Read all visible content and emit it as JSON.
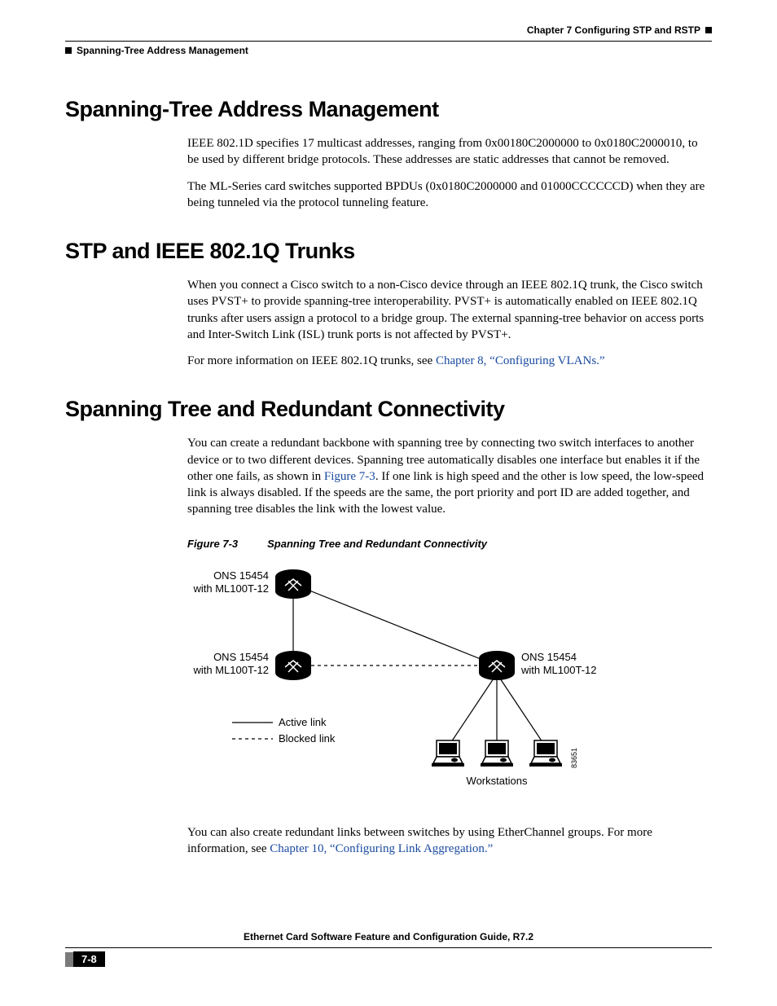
{
  "header": {
    "chapter": "Chapter 7    Configuring STP and RSTP",
    "running_head": "Spanning-Tree Address Management"
  },
  "sections": {
    "s1": {
      "title": "Spanning-Tree Address Management",
      "p1": "IEEE 802.1D specifies 17 multicast addresses, ranging from 0x00180C2000000 to 0x0180C2000010, to be used by different bridge protocols. These addresses are static addresses that cannot be removed.",
      "p2": "The ML-Series card switches supported BPDUs (0x0180C2000000 and 01000CCCCCCD) when they are being tunneled via the protocol tunneling feature."
    },
    "s2": {
      "title": "STP and IEEE 802.1Q Trunks",
      "p1": "When you connect a Cisco switch to a non-Cisco device through an IEEE 802.1Q trunk, the Cisco switch uses PVST+ to provide spanning-tree interoperability. PVST+ is automatically enabled on IEEE 802.1Q trunks after users assign a protocol to a bridge group. The external spanning-tree behavior on access ports and Inter-Switch Link (ISL) trunk ports is not affected by PVST+.",
      "p2a": "For more information on IEEE 802.1Q trunks, see ",
      "p2link": "Chapter 8, “Configuring VLANs.”"
    },
    "s3": {
      "title": "Spanning Tree and Redundant Connectivity",
      "p1a": "You can create a redundant backbone with spanning tree by connecting two switch interfaces to another device or to two different devices. Spanning tree automatically disables one interface but enables it if the other one fails, as shown in ",
      "p1link": "Figure 7-3",
      "p1b": ". If one link is high speed and the other is low speed, the low-speed link is always disabled. If the speeds are the same, the port priority and port ID are added together, and spanning tree disables the link with the lowest value.",
      "fig": {
        "num": "Figure 7-3",
        "title": "Spanning Tree and Redundant Connectivity",
        "node1": "ONS 15454",
        "node1b": "with ML100T-12",
        "node2": "ONS 15454",
        "node2b": "with ML100T-12",
        "node3": "ONS 15454",
        "node3b": "with ML100T-12",
        "legend_active": "Active link",
        "legend_blocked": "Blocked link",
        "workstations": "Workstations",
        "figid": "83651"
      },
      "p2a": "You can also create redundant links between switches by using EtherChannel groups. For more information, see ",
      "p2link": "Chapter 10, “Configuring Link Aggregation.”"
    }
  },
  "footer": {
    "title": "Ethernet Card Software Feature and Configuration Guide, R7.2",
    "page": "7-8"
  }
}
